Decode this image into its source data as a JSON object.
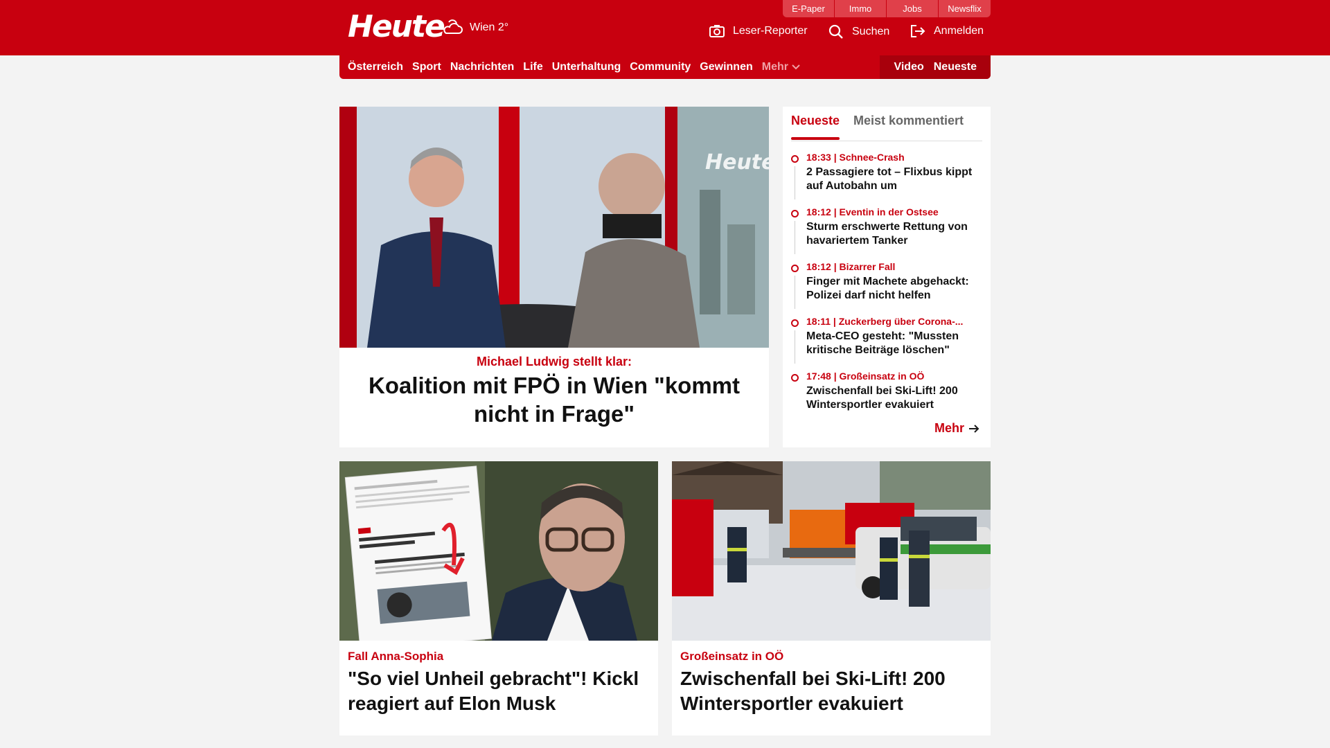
{
  "brand": {
    "logo": "Heute",
    "weather": "Wien 2°",
    "accent": "#c8000f"
  },
  "top_tabs": [
    "E-Paper",
    "Immo",
    "Jobs",
    "Newsflix"
  ],
  "header_links": {
    "reporter": "Leser-Reporter",
    "search": "Suchen",
    "login": "Anmelden"
  },
  "nav": {
    "items": [
      "Österreich",
      "Sport",
      "Nachrichten",
      "Life",
      "Unterhaltung",
      "Community",
      "Gewinnen"
    ],
    "more": "Mehr",
    "right": [
      "Video",
      "Neueste"
    ]
  },
  "hero": {
    "kicker": "Michael Ludwig stellt klar:",
    "title": "Koalition mit FPÖ in Wien \"kommt nicht in Frage\"",
    "image_watermark": "Heute"
  },
  "sidebar": {
    "tab_active": "Neueste",
    "tab_inactive": "Meist kommentiert",
    "items": [
      {
        "meta": "18:33 | Schnee-Crash",
        "title": "2 Passagiere tot – Flixbus kippt auf Autobahn um"
      },
      {
        "meta": "18:12 | Eventin in der Ostsee",
        "title": "Sturm erschwerte Rettung von havariertem Tanker"
      },
      {
        "meta": "18:12 | Bizarrer Fall",
        "title": "Finger mit Machete abgehackt: Polizei darf nicht helfen"
      },
      {
        "meta": "18:11 | Zuckerberg über Corona-...",
        "title": "Meta-CEO gesteht: \"Mussten kritische Beiträge löschen\""
      },
      {
        "meta": "17:48 | Großeinsatz in OÖ",
        "title": "Zwischenfall bei Ski-Lift! 200 Wintersportler evakuiert"
      }
    ],
    "more": "Mehr"
  },
  "cards": [
    {
      "kicker": "Fall Anna-Sophia",
      "title": "\"So viel Unheil gebracht\"! Kickl reagiert auf Elon Musk"
    },
    {
      "kicker": "Großeinsatz in OÖ",
      "title": "Zwischenfall bei Ski-Lift! 200 Wintersportler evakuiert"
    }
  ]
}
